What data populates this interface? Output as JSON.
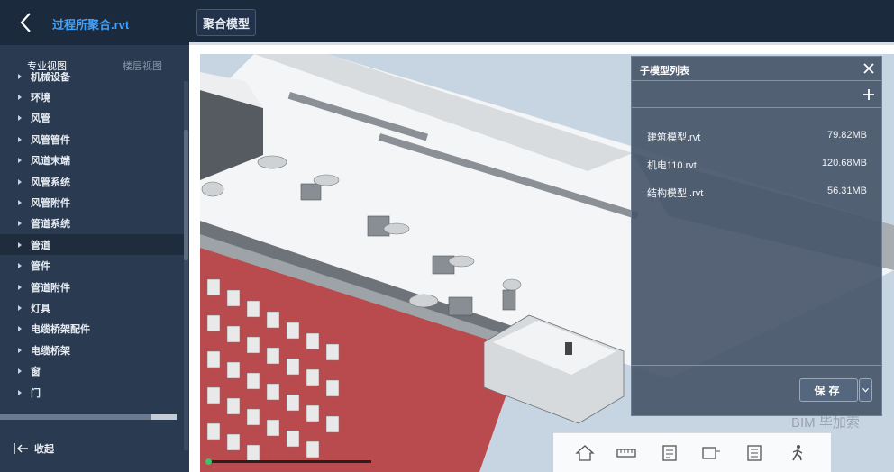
{
  "header": {
    "file_title": "过程所聚合.rvt",
    "mode_button": "聚合模型"
  },
  "sidebar": {
    "tabs": [
      {
        "label": "专业视图",
        "active": true
      },
      {
        "label": "楼层视图",
        "active": false
      }
    ],
    "items": [
      {
        "label": "机械设备",
        "selected": false
      },
      {
        "label": "环境",
        "selected": false
      },
      {
        "label": "风管",
        "selected": false
      },
      {
        "label": "风管管件",
        "selected": false
      },
      {
        "label": "风道末端",
        "selected": false
      },
      {
        "label": "风管系统",
        "selected": false
      },
      {
        "label": "风管附件",
        "selected": false
      },
      {
        "label": "管道系统",
        "selected": false
      },
      {
        "label": "管道",
        "selected": true
      },
      {
        "label": "管件",
        "selected": false
      },
      {
        "label": "管道附件",
        "selected": false
      },
      {
        "label": "灯具",
        "selected": false
      },
      {
        "label": "电缆桥架配件",
        "selected": false
      },
      {
        "label": "电缆桥架",
        "selected": false
      },
      {
        "label": "窗",
        "selected": false
      },
      {
        "label": "门",
        "selected": false
      }
    ],
    "collapse_label": "收起"
  },
  "model_panel": {
    "title": "子模型列表",
    "models": [
      {
        "name": "建筑模型.rvt",
        "size": "79.82MB"
      },
      {
        "name": "机电110.rvt",
        "size": "120.68MB"
      },
      {
        "name": "结构模型 .rvt",
        "size": "56.31MB"
      }
    ],
    "save_label": "保存"
  },
  "toolbar": {
    "tools": [
      "home-icon",
      "measure-icon",
      "properties-icon",
      "section-icon",
      "list-icon",
      "walk-icon",
      "copy-icon",
      "share-icon"
    ]
  },
  "watermark": "BIM 毕加索",
  "colors": {
    "accent": "#3fa2ff",
    "topbar": "#1c2a3d",
    "sidebar": "#2a3a51",
    "brick": "#b94a4e",
    "sky": "#c7d5e2"
  }
}
